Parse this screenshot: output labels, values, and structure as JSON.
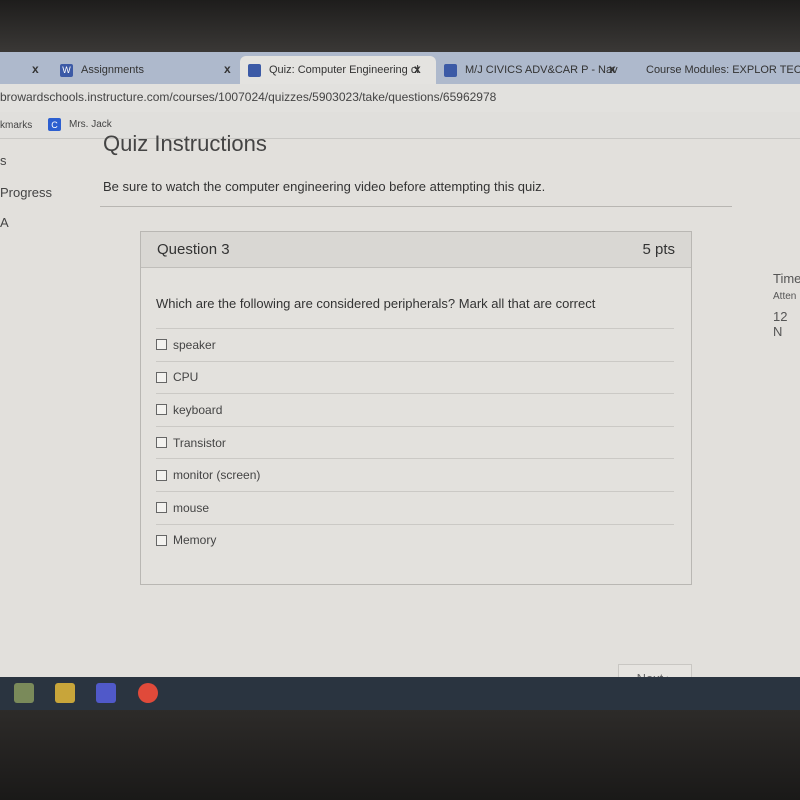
{
  "tabs": [
    {
      "label": "Assignments",
      "icon": "W"
    },
    {
      "label": "Quiz: Computer Engineering cl",
      "icon": "canvas"
    },
    {
      "label": "M/J CIVICS ADV&CAR P - Nav",
      "icon": "canvas"
    },
    {
      "label": "Course Modules: EXPLOR TECH",
      "icon": "canvas"
    }
  ],
  "close": "x",
  "url": "browardschools.instructure.com/courses/1007024/quizzes/5903023/take/questions/65962978",
  "bookmarks": {
    "label": "kmarks",
    "item": "Mrs. Jack",
    "item_icon": "C"
  },
  "page": {
    "title": "Quiz Instructions",
    "instructions": "Be sure to watch the computer engineering video before attempting this quiz.",
    "side1": "s",
    "side2": "Progress",
    "side3": "A"
  },
  "question": {
    "title": "Question 3",
    "points": "5 pts",
    "text": "Which are the following are considered peripherals? Mark all that are correct",
    "options": [
      {
        "label": "speaker",
        "checked": false
      },
      {
        "label": "CPU",
        "checked": false
      },
      {
        "label": "keyboard",
        "checked": false
      },
      {
        "label": "Transistor",
        "checked": false
      },
      {
        "label": "monitor (screen)",
        "checked": false
      },
      {
        "label": "mouse",
        "checked": false
      },
      {
        "label": "Memory",
        "checked": false
      }
    ]
  },
  "next": "Next ▸",
  "right": {
    "time": "Time",
    "attempt": "Atten",
    "date": "12 N"
  }
}
